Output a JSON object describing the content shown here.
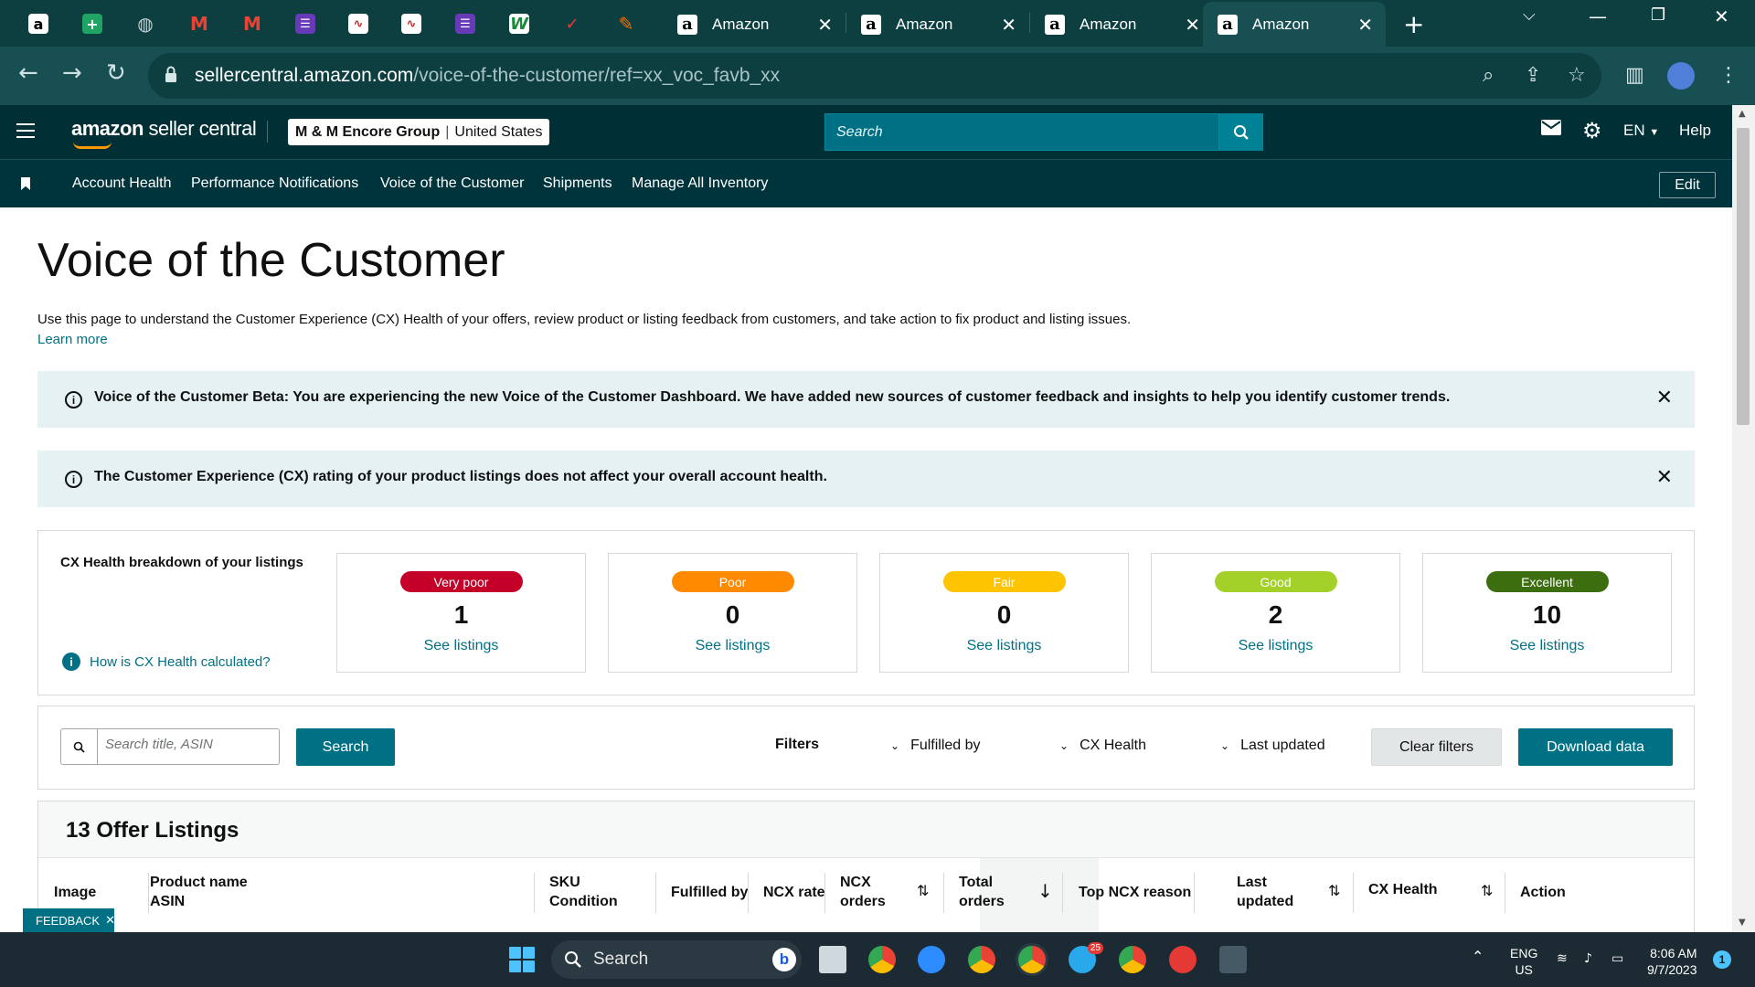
{
  "browser": {
    "tabs": [
      {
        "title": "Amazon",
        "active": false
      },
      {
        "title": "Amazon",
        "active": false
      },
      {
        "title": "Amazon",
        "active": false
      },
      {
        "title": "Amazon",
        "active": true
      }
    ],
    "pinned_tab_icons": [
      "amazon-icon",
      "sheets-icon",
      "globe-icon",
      "gmail-icon",
      "gmail-icon",
      "forms-icon",
      "analytics-icon",
      "analytics-icon",
      "forms-icon",
      "wrike-icon",
      "app-icon",
      "zapier-icon"
    ],
    "url_host": "sellercentral.amazon.com",
    "url_path": "/voice-of-the-customer/ref=xx_voc_favb_xx"
  },
  "header": {
    "logo_bold": "amazon",
    "logo_rest": " seller central",
    "account_name": "M & M Encore Group",
    "account_separator": "|",
    "account_region": "United States",
    "search_placeholder": "Search",
    "language": "EN",
    "help": "Help"
  },
  "nav": {
    "links": [
      "Account Health",
      "Performance Notifications",
      "Voice of the Customer",
      "Shipments",
      "Manage All Inventory"
    ],
    "edit": "Edit"
  },
  "page": {
    "title": "Voice of the Customer",
    "intro": "Use this page to understand the Customer Experience (CX) Health of your offers, review product or listing feedback from customers, and take action to fix product and listing issues.",
    "learn_more": "Learn more",
    "banner_beta": "Voice of the Customer Beta: You are experiencing the new Voice of the Customer Dashboard. We have added new sources of customer feedback and insights to help you identify customer trends.",
    "banner_cx": "The Customer Experience (CX) rating of your product listings does not affect your overall account health."
  },
  "cx_health": {
    "title": "CX Health breakdown of your listings",
    "help_link": "How is CX Health calculated?",
    "see_listings": "See listings",
    "cards": [
      {
        "label": "Very poor",
        "count": "1",
        "color": "#c40029"
      },
      {
        "label": "Poor",
        "count": "0",
        "color": "#ff8a00"
      },
      {
        "label": "Fair",
        "count": "0",
        "color": "#ffc400"
      },
      {
        "label": "Good",
        "count": "2",
        "color": "#a3d12a"
      },
      {
        "label": "Excellent",
        "count": "10",
        "color": "#3c6e10"
      }
    ]
  },
  "filters": {
    "search_placeholder": "Search title, ASIN",
    "search_button": "Search",
    "filters_label": "Filters",
    "fulfilled_by": "Fulfilled by",
    "cx_health": "CX Health",
    "last_updated": "Last updated",
    "clear": "Clear filters",
    "download": "Download data"
  },
  "listings": {
    "title": "13 Offer Listings",
    "columns": {
      "image": "Image",
      "product_name": "Product name",
      "asin": "ASIN",
      "sku": "SKU",
      "condition": "Condition",
      "fulfilled_by": "Fulfilled by",
      "ncx_rate": "NCX rate",
      "ncx_orders_1": "NCX",
      "ncx_orders_2": "orders",
      "total_orders_1": "Total",
      "total_orders_2": "orders",
      "top_ncx_reason": "Top NCX reason",
      "last_updated_1": "Last",
      "last_updated_2": "updated",
      "cx_health": "CX Health",
      "action": "Action"
    }
  },
  "feedback_tab": "FEEDBACK",
  "taskbar": {
    "search_placeholder": "Search",
    "language_1": "ENG",
    "language_2": "US",
    "time": "8:06 AM",
    "date": "9/7/2023",
    "notification_count": "1",
    "telegram_badge": "25"
  }
}
